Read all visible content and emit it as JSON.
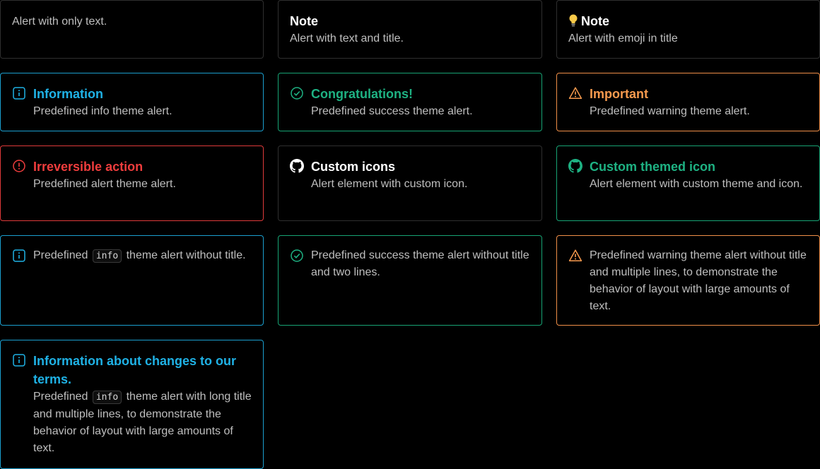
{
  "alerts": {
    "a1": {
      "body": "Alert with only text."
    },
    "a2": {
      "title": "Note",
      "body": "Alert with text and title."
    },
    "a3": {
      "title": "Note",
      "emoji": "light-bulb",
      "body": "Alert with emoji in title"
    },
    "a4": {
      "title": "Information",
      "body": "Predefined info theme alert.",
      "icon": "info-icon"
    },
    "a5": {
      "title": "Congratulations!",
      "body": "Predefined success theme alert.",
      "icon": "check-circle-icon"
    },
    "a6": {
      "title": "Important",
      "body": "Predefined warning theme alert.",
      "icon": "warning-triangle-icon"
    },
    "a7": {
      "title": "Irreversible action",
      "body": "Predefined alert theme alert.",
      "icon": "alert-circle-icon"
    },
    "a8": {
      "title": "Custom icons",
      "body": "Alert element with custom icon.",
      "icon": "github-icon"
    },
    "a9": {
      "title": "Custom themed icon",
      "body": "Alert element with custom theme and icon.",
      "icon": "github-icon"
    },
    "a10": {
      "pre": "Predefined",
      "code": "info",
      "post": "theme alert without title.",
      "icon": "info-icon"
    },
    "a11": {
      "body": "Predefined success theme alert without title and two lines.",
      "icon": "check-circle-icon"
    },
    "a12": {
      "body": "Predefined warning theme alert without title and multiple lines, to demonstrate the behavior of layout with large amounts of text.",
      "icon": "warning-triangle-icon"
    },
    "a13": {
      "title": "Information about changes to our terms.",
      "pre": "Predefined",
      "code": "info",
      "post": "theme alert with long title and multiple lines, to demonstrate the behavior of layout with large amounts of text.",
      "icon": "info-icon"
    }
  },
  "colors": {
    "info": "#1b9fcf",
    "success": "#17a374",
    "warning": "#f08f48",
    "danger": "#df3a3a",
    "neutral": "#2f2f2f"
  }
}
